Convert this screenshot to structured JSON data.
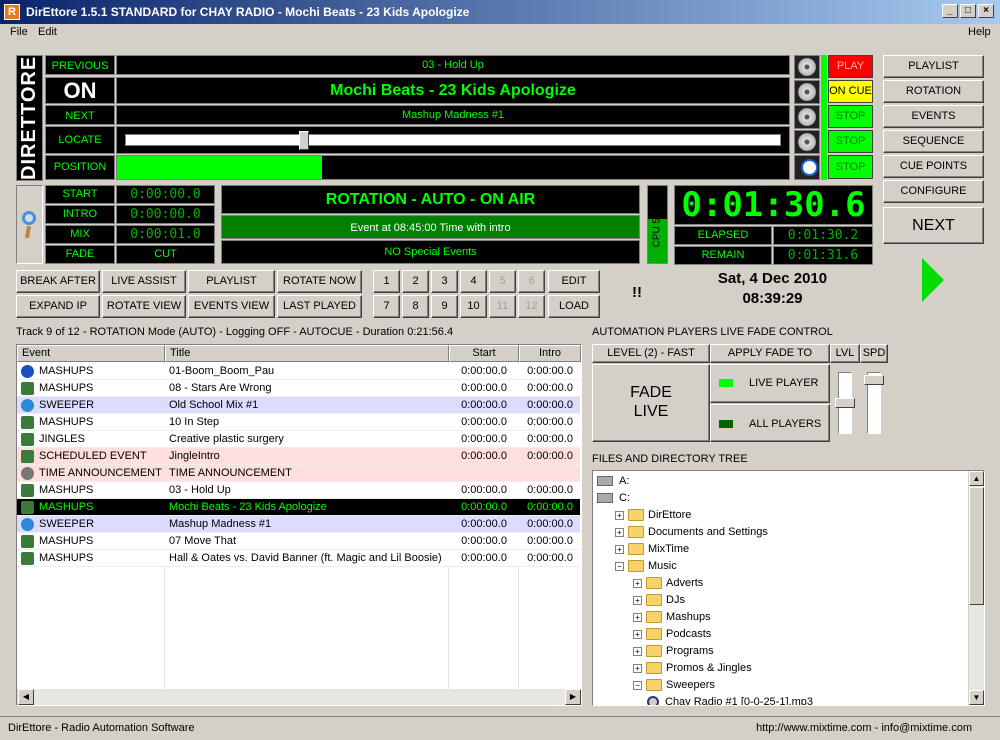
{
  "window": {
    "title": "DirEttore 1.5.1 STANDARD for CHAY RADIO - Mochi Beats - 23 Kids Apologize",
    "app_icon": "R"
  },
  "menu": {
    "file": "File",
    "edit": "Edit",
    "help": "Help"
  },
  "logo": {
    "text": "DIRETTORE"
  },
  "panel": {
    "previous_label": "PREVIOUS",
    "previous_value": "03 - Hold Up",
    "onair_label": "ON AIR",
    "onair_value": "Mochi Beats - 23 Kids Apologize",
    "next_label": "NEXT",
    "next_value": "Mashup Madness #1",
    "locate_label": "LOCATE",
    "position_label": "POSITION",
    "locate_fraction": 0.27,
    "position_fraction": 0.305
  },
  "player_buttons": [
    "PLAY",
    "ON CUE",
    "STOP",
    "STOP",
    "STOP"
  ],
  "right_buttons": {
    "playlist": "PLAYLIST",
    "rotation": "ROTATION",
    "events": "EVENTS",
    "sequence": "SEQUENCE",
    "cue_points": "CUE POINTS",
    "configure": "CONFIGURE",
    "next": "NEXT"
  },
  "cue": {
    "start_label": "START",
    "start_value": "0:00:00.0",
    "intro_label": "INTRO",
    "intro_value": "0:00:00.0",
    "mix_label": "MIX",
    "mix_value": "0:00:01.0",
    "fade_label": "FADE",
    "fade_value": "CUT"
  },
  "status": {
    "mode": "ROTATION - AUTO - ON AIR",
    "event": "Event at 08:45:00    Time with intro",
    "special": "NO Special Events",
    "cpu_label": "CPU",
    "cpu_value": "56 %"
  },
  "timers": {
    "main": "0:01:30.6",
    "elapsed_label": "ELAPSED",
    "elapsed_value": "0:01:30.2",
    "remain_label": "REMAIN",
    "remain_value": "0:01:31.6"
  },
  "controls": {
    "row1": [
      "BREAK AFTER",
      "LIVE ASSIST",
      "PLAYLIST",
      "ROTATE NOW"
    ],
    "row2": [
      "EXPAND IP",
      "ROTATE VIEW",
      "EVENTS VIEW",
      "LAST PLAYED"
    ],
    "nums1": [
      "1",
      "2",
      "3",
      "4",
      "5",
      "6"
    ],
    "nums2": [
      "7",
      "8",
      "9",
      "10",
      "11",
      "12"
    ],
    "edit": "EDIT",
    "load": "LOAD",
    "alert": "!!",
    "date": "Sat, 4 Dec 2010",
    "time": "08:39:29"
  },
  "track_info": "Track 9 of 12  -  ROTATION Mode (AUTO)  -  Logging OFF  -  AUTOCUE  -  Duration 0:21:56.4",
  "playlist": {
    "columns": [
      "Event",
      "Title",
      "Start",
      "Intro"
    ],
    "rows": [
      {
        "event": "MASHUPS",
        "title": "01-Boom_Boom_Pau",
        "start": "0:00:00.0",
        "intro": "0:00:00.0",
        "icon": "loop-icon",
        "style": "normal"
      },
      {
        "event": "MASHUPS",
        "title": "08 - Stars Are Wrong",
        "start": "0:00:00.0",
        "intro": "0:00:00.0",
        "icon": "music-icon",
        "style": "normal"
      },
      {
        "event": "SWEEPER",
        "title": "Old School Mix #1",
        "start": "0:00:00.0",
        "intro": "0:00:00.0",
        "icon": "sweeper-icon",
        "style": "blue"
      },
      {
        "event": "MASHUPS",
        "title": "10 In Step",
        "start": "0:00:00.0",
        "intro": "0:00:00.0",
        "icon": "music-icon",
        "style": "normal"
      },
      {
        "event": "JINGLES",
        "title": "Creative plastic surgery",
        "start": "0:00:00.0",
        "intro": "0:00:00.0",
        "icon": "music-icon",
        "style": "normal"
      },
      {
        "event": "SCHEDULED EVENT",
        "title": "JingleIntro",
        "start": "0:00:00.0",
        "intro": "0:00:00.0",
        "icon": "music-icon",
        "style": "pink"
      },
      {
        "event": "TIME ANNOUNCEMENT",
        "title": "TIME ANNOUNCEMENT",
        "start": "",
        "intro": "",
        "icon": "clock-icon",
        "style": "pink"
      },
      {
        "event": "MASHUPS",
        "title": "03 - Hold Up",
        "start": "0:00:00.0",
        "intro": "0:00:00.0",
        "icon": "music-icon",
        "style": "normal"
      },
      {
        "event": "MASHUPS",
        "title": "Mochi Beats - 23 Kids Apologize",
        "start": "0:00:00.0",
        "intro": "0:00:00.0",
        "icon": "music-icon",
        "style": "selected"
      },
      {
        "event": "SWEEPER",
        "title": "Mashup Madness #1",
        "start": "0:00:00.0",
        "intro": "0:00:00.0",
        "icon": "sweeper-icon",
        "style": "blue"
      },
      {
        "event": "MASHUPS",
        "title": "07 Move That",
        "start": "0:00:00.0",
        "intro": "0:00:00.0",
        "icon": "music-icon",
        "style": "normal"
      },
      {
        "event": "MASHUPS",
        "title": "Hall & Oates vs. David Banner (ft. Magic and Lil Boosie)",
        "start": "0:00:00.0",
        "intro": "0:00:00.0",
        "icon": "music-icon",
        "style": "normal"
      }
    ]
  },
  "fade": {
    "section_title": "AUTOMATION PLAYERS LIVE FADE CONTROL",
    "level_header": "LEVEL (2)  -  FAST",
    "apply_header": "APPLY FADE TO",
    "lvl_header": "LVL",
    "spd_header": "SPD",
    "fade_button": "FADE LIVE",
    "live_player": "LIVE PLAYER",
    "all_players": "ALL PLAYERS",
    "lvl_slider": 0.5,
    "spd_slider": 0.05
  },
  "tree": {
    "section_title": "FILES AND DIRECTORY TREE",
    "items": [
      {
        "label": "A:",
        "type": "drive",
        "depth": 0,
        "toggle": ""
      },
      {
        "label": "C:",
        "type": "drive",
        "depth": 0,
        "toggle": ""
      },
      {
        "label": "DirEttore",
        "type": "folder",
        "depth": 1,
        "toggle": "+"
      },
      {
        "label": "Documents and Settings",
        "type": "folder",
        "depth": 1,
        "toggle": "+"
      },
      {
        "label": "MixTime",
        "type": "folder",
        "depth": 1,
        "toggle": "+"
      },
      {
        "label": "Music",
        "type": "folder",
        "depth": 1,
        "toggle": "-"
      },
      {
        "label": "Adverts",
        "type": "folder",
        "depth": 2,
        "toggle": "+"
      },
      {
        "label": "DJs",
        "type": "folder",
        "depth": 2,
        "toggle": "+"
      },
      {
        "label": "Mashups",
        "type": "folder",
        "depth": 2,
        "toggle": "+"
      },
      {
        "label": "Podcasts",
        "type": "folder",
        "depth": 2,
        "toggle": "+"
      },
      {
        "label": "Programs",
        "type": "folder",
        "depth": 2,
        "toggle": "+"
      },
      {
        "label": "Promos & Jingles",
        "type": "folder",
        "depth": 2,
        "toggle": "+"
      },
      {
        "label": "Sweepers",
        "type": "folder",
        "depth": 2,
        "toggle": "-"
      },
      {
        "label": "Chay Radio #1 [0-0-25-1].mp3",
        "type": "file",
        "depth": 3,
        "toggle": ""
      }
    ]
  },
  "statusbar": {
    "left": "DirEttore - Radio Automation Software",
    "right": "http://www.mixtime.com - info@mixtime.com"
  },
  "colors": {
    "lcd_green": "#00ff00",
    "play_red": "#ff0000",
    "cue_yellow": "#ffff00",
    "stop_green": "#00ff00",
    "selected_row": "#000000",
    "sweeper_row": "#dcdcff",
    "event_row": "#ffdede"
  }
}
